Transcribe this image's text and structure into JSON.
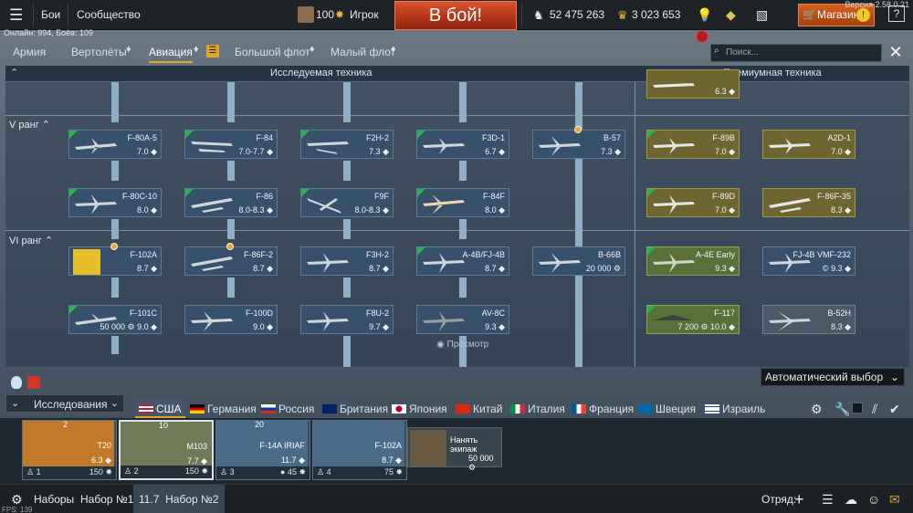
{
  "version": "Версия 2.58.0.21",
  "online": "Онлайн: 994, Боёв: 109",
  "topbar": {
    "menu_battles": "Бои",
    "menu_community": "Сообщество",
    "player_rank": "100",
    "player_name": "Игрок",
    "battle_button": "В бой!",
    "silver_lions": "52 475 263",
    "golden_eagles": "3 023 653",
    "shop": "Магазин",
    "help": "?"
  },
  "tabs": [
    {
      "label": "Армия"
    },
    {
      "label": "Вертолёты"
    },
    {
      "label": "Авиация"
    },
    {
      "label": "Большой флот"
    },
    {
      "label": "Малый флот"
    }
  ],
  "search": {
    "placeholder": "Поиск..."
  },
  "tree": {
    "researched_header": "Исследуемая техника",
    "premium_header": "Премиумная техника",
    "rank5": "V ранг",
    "rank6": "VI ранг",
    "overlay_text": "Просмотр"
  },
  "vehicles": [
    {
      "name": "F-80A-5",
      "br": "7.0"
    },
    {
      "name": "F-84",
      "br": "7.0-7.7"
    },
    {
      "name": "F2H-2",
      "br": "7.3"
    },
    {
      "name": "F3D-1",
      "br": "6.7"
    },
    {
      "name": "B-57",
      "br": "7.3"
    },
    {
      "name": "F-89B",
      "br": "7.0"
    },
    {
      "name": "A2D-1",
      "br": "7.0"
    },
    {
      "name": "F-80C-10",
      "br": "8.0"
    },
    {
      "name": "F-86",
      "br": "8.0-8.3"
    },
    {
      "name": "F9F",
      "br": "8.0-8.3"
    },
    {
      "name": "F-84F",
      "br": "8.0"
    },
    {
      "name": "F-89D",
      "br": "7.0"
    },
    {
      "name": "F-86F-35",
      "br": "8.3"
    },
    {
      "name": "F-102A",
      "br": "8.7"
    },
    {
      "name": "F-86F-2",
      "br": "8.7"
    },
    {
      "name": "F3H-2",
      "br": "8.7"
    },
    {
      "name": "A-4B/FJ-4B",
      "br": "8.7"
    },
    {
      "name": "B-66B",
      "br": "20 000",
      "br2": ""
    },
    {
      "name": "A-4E Early",
      "br": "9.3"
    },
    {
      "name": "FJ-4B VMF-232",
      "br": "9.3"
    },
    {
      "name": "F-101C",
      "br": "50 000",
      "br2": "9.0"
    },
    {
      "name": "F-100D",
      "br": "9.0"
    },
    {
      "name": "F8U-2",
      "br": "9.7"
    },
    {
      "name": "AV-8C",
      "br": "9.3"
    },
    {
      "name": "F-117",
      "br": "7 200",
      "br2": "10.0"
    },
    {
      "name": "B-52H",
      "br": "8.3"
    },
    {
      "name": "",
      "br": "6.3"
    }
  ],
  "auto_select": "Автоматический выбор",
  "research_label": "Исследования",
  "countries": [
    {
      "label": "США"
    },
    {
      "label": "Германия"
    },
    {
      "label": "Россия"
    },
    {
      "label": "Британия"
    },
    {
      "label": "Япония"
    },
    {
      "label": "Китай"
    },
    {
      "label": "Италия"
    },
    {
      "label": "Франция"
    },
    {
      "label": "Швеция"
    },
    {
      "label": "Израиль"
    }
  ],
  "slots": [
    {
      "name": "T20",
      "br": "6.3",
      "num": "1",
      "count": "2",
      "cost": "150"
    },
    {
      "name": "M103",
      "br": "7.7",
      "num": "2",
      "count": "10",
      "cost": "150"
    },
    {
      "name": "F-14A IRIAF",
      "br": "11.7",
      "num": "3",
      "count": "20",
      "cost": "45"
    },
    {
      "name": "F-102A",
      "br": "8.7",
      "num": "4",
      "count": "",
      "cost": "75"
    }
  ],
  "crew": {
    "label": "Нанять экипаж",
    "cost": "50 000"
  },
  "bottombar": {
    "presets": "Наборы",
    "preset1": "Набор №1",
    "preset2_br": "11.7",
    "preset2": "Набор №2",
    "squad": "Отряд:"
  },
  "fps": "FPS: 139"
}
